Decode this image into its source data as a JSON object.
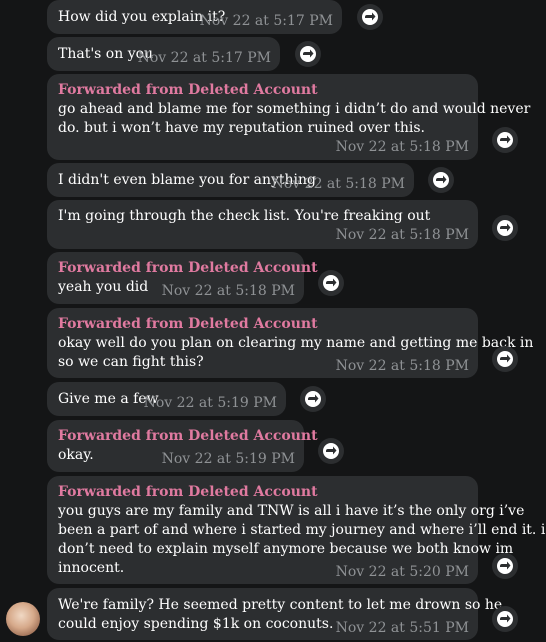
{
  "messages": [
    {
      "forwarded": "",
      "lines": [
        "How did you explain it?"
      ],
      "time": "Nov 22 at 5:17 PM"
    },
    {
      "forwarded": "",
      "lines": [
        "That's on you"
      ],
      "time": "Nov 22 at 5:17 PM"
    },
    {
      "forwarded": "Forwarded from Deleted Account",
      "lines": [
        "go ahead and blame me for something i didn’t do and would never",
        "do. but i won’t have my reputation ruined over this."
      ],
      "time": "Nov 22 at 5:18 PM"
    },
    {
      "forwarded": "",
      "lines": [
        "I didn't even blame you for anything"
      ],
      "time": "Nov 22 at 5:18 PM"
    },
    {
      "forwarded": "",
      "lines": [
        "I'm going through the check list. You're freaking out"
      ],
      "time": "Nov 22 at 5:18 PM"
    },
    {
      "forwarded": "Forwarded from Deleted Account",
      "lines": [
        "yeah you did"
      ],
      "time": "Nov 22 at 5:18 PM"
    },
    {
      "forwarded": "Forwarded from Deleted Account",
      "lines": [
        "okay well do you plan on clearing my name and getting me back in",
        "so we can fight this?"
      ],
      "time": "Nov 22 at 5:18 PM"
    },
    {
      "forwarded": "",
      "lines": [
        "Give me a few"
      ],
      "time": "Nov 22 at 5:19 PM"
    },
    {
      "forwarded": "Forwarded from Deleted Account",
      "lines": [
        "okay."
      ],
      "time": "Nov 22 at 5:19 PM"
    },
    {
      "forwarded": "Forwarded from Deleted Account",
      "lines": [
        "you guys are my family and TNW is all i have it’s the only org i’ve",
        "been a part of and where i started my journey and where i’ll end it. i",
        "don’t need to explain myself anymore because we both know im",
        "innocent."
      ],
      "time": "Nov 22 at 5:20 PM"
    },
    {
      "forwarded": "",
      "lines": [
        "We're family? He seemed pretty content to let me drown so he",
        "could enjoy spending $1k on coconuts."
      ],
      "time": "Nov 22 at 5:51 PM"
    }
  ],
  "icons": {
    "share": "share-arrow-icon",
    "avatar": "user-avatar"
  },
  "colors": {
    "background": "#141516",
    "bubble": "#2c2e30",
    "forwarded_name": "#e07aa0",
    "timestamp": "#8f9295"
  }
}
